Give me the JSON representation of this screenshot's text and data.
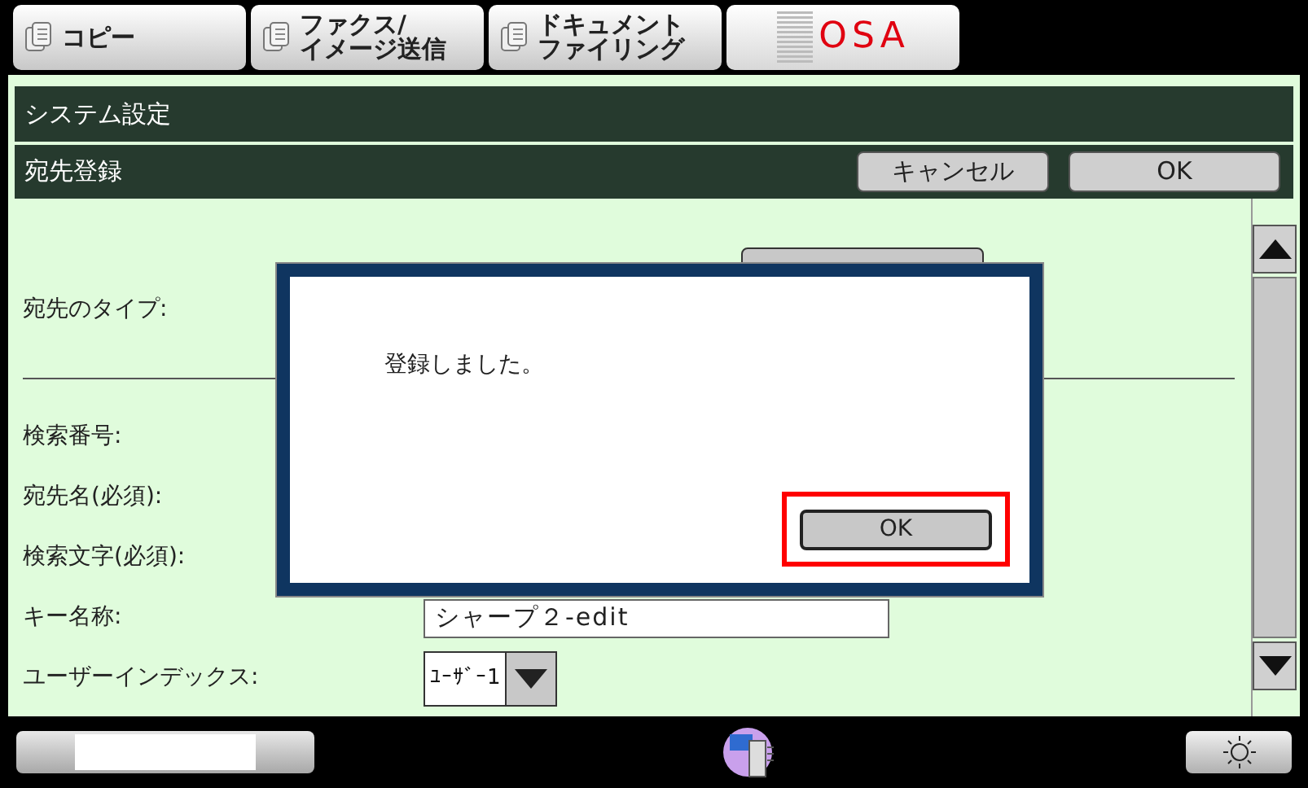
{
  "tabs": [
    {
      "lines": [
        "コピー"
      ],
      "selected": false
    },
    {
      "lines": [
        "ファクス/",
        "イメージ送信"
      ],
      "selected": false
    },
    {
      "lines": [
        "ドキュメント",
        "ファイリング"
      ],
      "selected": false
    }
  ],
  "logo": {
    "text": "OSA"
  },
  "header": {
    "title": "システム設定",
    "subtitle": "宛先登録",
    "buttons": [
      "キャンセル",
      "OK"
    ]
  },
  "form": {
    "fields": [
      {
        "label": "宛先のタイプ:",
        "kind": "plain"
      },
      {
        "kind": "divider"
      },
      {
        "label": "検索番号:",
        "kind": "plain"
      },
      {
        "label": "宛先名(必須):",
        "kind": "plain"
      },
      {
        "label": "検索文字(必須):",
        "kind": "plain"
      },
      {
        "label": "キー名称:",
        "kind": "text",
        "value": "シャープ２-edit"
      },
      {
        "label": "ユーザーインデックス:",
        "kind": "select",
        "value": "ﾕｰｻﾞｰ1"
      }
    ]
  },
  "dialog": {
    "message": "登録しました。",
    "button": "OK",
    "highlighted": true
  }
}
